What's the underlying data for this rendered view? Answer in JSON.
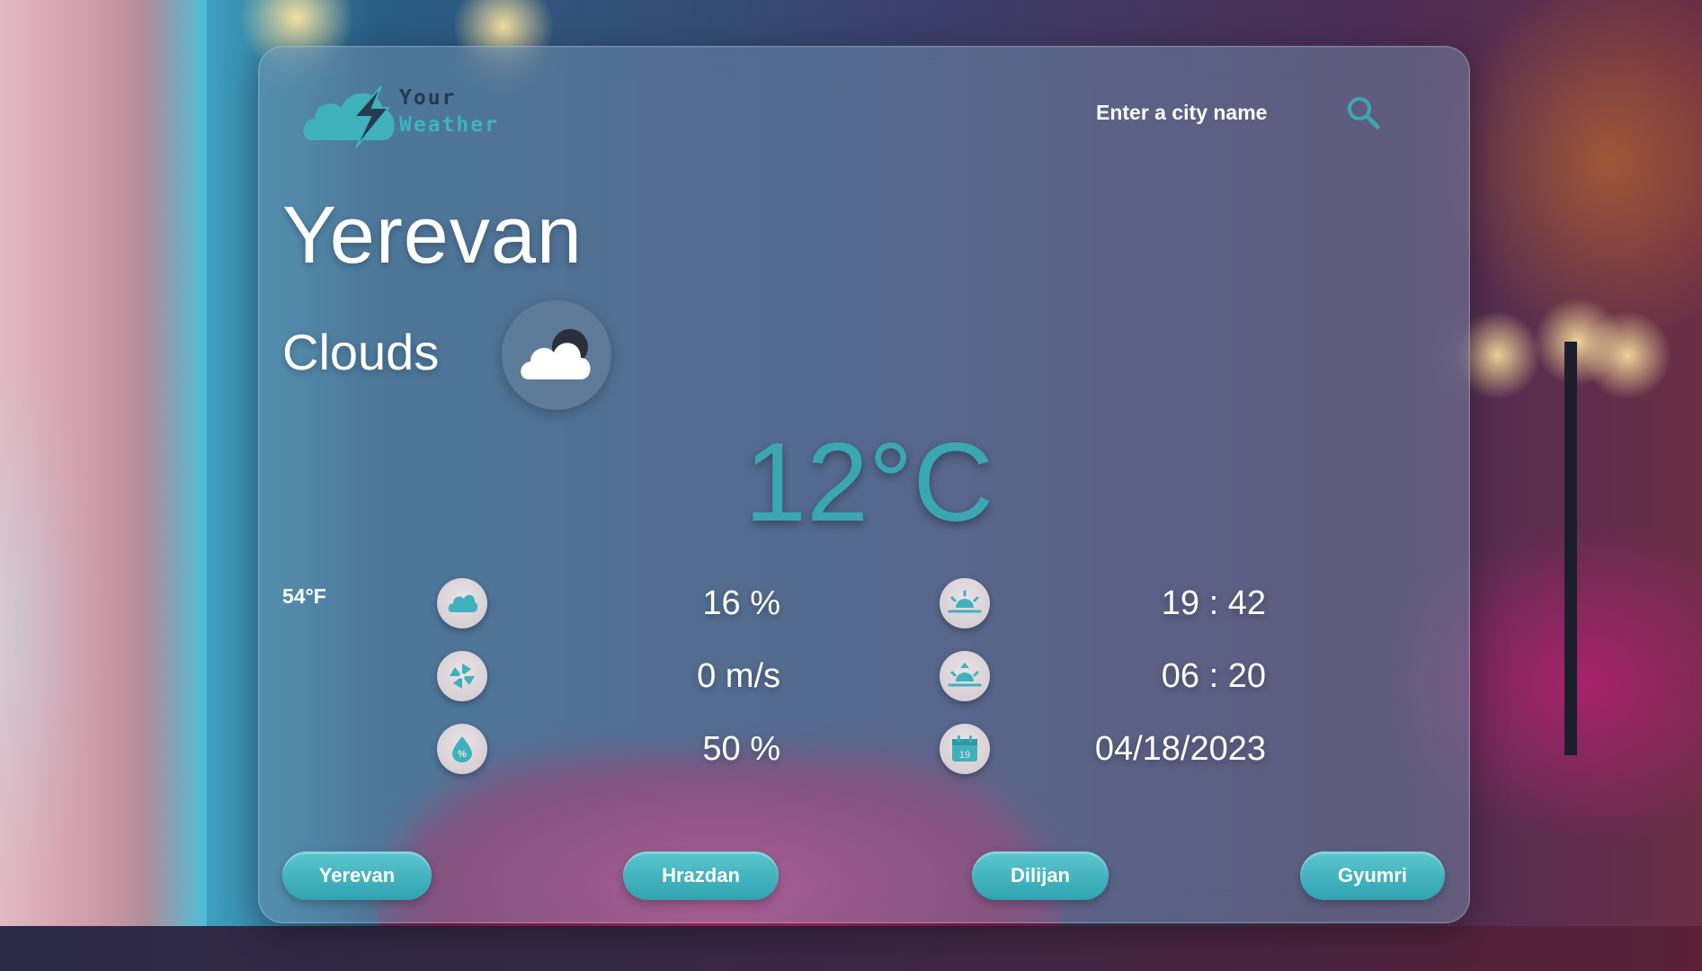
{
  "logo": {
    "line1": "Your",
    "line2": "Weather"
  },
  "search": {
    "placeholder": "Enter a city name"
  },
  "city": "Yerevan",
  "condition": "Clouds",
  "condition_icon": "cloud-moon-icon",
  "temp_celsius": "12°C",
  "temp_fahrenheit": "54°F",
  "stats_left": [
    {
      "icon": "cloud-icon",
      "value": "16 %"
    },
    {
      "icon": "wind-pinwheel-icon",
      "value": "0 m/s"
    },
    {
      "icon": "humidity-drop-icon",
      "value": "50 %"
    }
  ],
  "stats_right": [
    {
      "icon": "sunset-icon",
      "value": "19 : 42"
    },
    {
      "icon": "sunrise-icon",
      "value": "06 : 20"
    },
    {
      "icon": "calendar-icon",
      "value": "04/18/2023",
      "calendar_day": "19"
    }
  ],
  "city_buttons": [
    {
      "label": "Yerevan"
    },
    {
      "label": "Hrazdan"
    },
    {
      "label": "Dilijan"
    },
    {
      "label": "Gyumri"
    }
  ],
  "colors": {
    "accent": "#3aa7b3",
    "logo_dark": "#273a4f",
    "button": "#3fb1bd"
  }
}
